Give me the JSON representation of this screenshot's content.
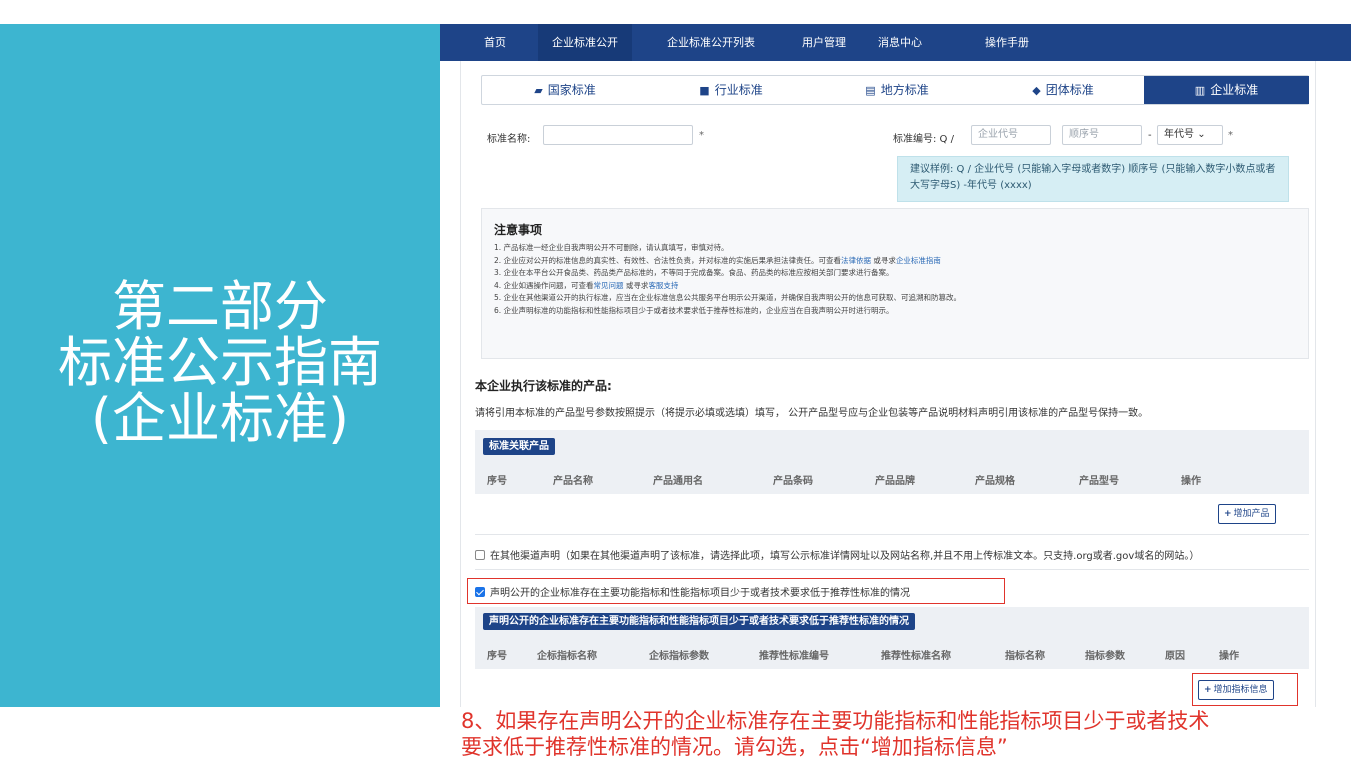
{
  "slide": {
    "title_line1": "第二部分",
    "title_line2": "标准公示指南",
    "title_line3": "(企业标准)",
    "caption": "8、如果存在声明公开的企业标准存在主要功能指标和性能指标项目少于或者技术要求低于推荐性标准的情况。请勾选，点击“增加指标信息”"
  },
  "nav": [
    "首页",
    "企业标准公开",
    "企业标准公开列表",
    "用户管理",
    "消息中心",
    "操作手册"
  ],
  "tabs": [
    {
      "label": "国家标准",
      "icon": "book-icon"
    },
    {
      "label": "行业标准",
      "icon": "briefcase-icon"
    },
    {
      "label": "地方标准",
      "icon": "document-icon"
    },
    {
      "label": "团体标准",
      "icon": "shield-icon"
    },
    {
      "label": "企业标准",
      "icon": "bank-icon"
    }
  ],
  "form": {
    "name_label": "标准名称:",
    "name_required": "*",
    "code_label": "标准编号: Q /",
    "code_company_placeholder": "企业代号",
    "code_seq_placeholder": "顺序号",
    "code_sep": "-",
    "code_year": "年代号",
    "code_required": "*",
    "hint": "建议样例: Q / 企业代号 (只能输入字母或者数字) 顺序号 (只能输入数字小数点或者大写字母S) -年代号 (xxxx)"
  },
  "notice": {
    "title": "注意事项",
    "l1": "1. 产品标准一经企业自我声明公开不可删除，请认真填写，审慎对待。",
    "l2a": "2. 企业应对公开的标准信息的真实性、有效性、合法性负责，并对标准的实施后果承担法律责任。可查看",
    "l2_link1": "法律依据",
    "l2b": " 或寻求",
    "l2_link2": "企业标准指南",
    "l3": "3. 企业在本平台公开食品类、药品类产品标准的，不等同于完成备案。食品、药品类的标准应按相关部门要求进行备案。",
    "l4a": "4. 企业如遇操作问题，可查看",
    "l4_link1": "常见问题",
    "l4b": " 或寻求",
    "l4_link2": "客服支持",
    "l5": "5. 企业在其他渠道公开的执行标准，应当在企业标准信息公共服务平台明示公开渠道，并确保自我声明公开的信息可获取、可追溯和防篡改。",
    "l6": "6. 企业声明标准的功能指标和性能指标项目少于或者技术要求低于推荐性标准的，企业应当在自我声明公开时进行明示。"
  },
  "products": {
    "title": "本企业执行该标准的产品:",
    "desc": "请将引用本标准的产品型号参数按照提示（将提示必填或选填）填写， 公开产品型号应与企业包装等产品说明材料声明引用该标准的产品型号保持一致。",
    "badge": "标准关联产品",
    "columns": [
      "序号",
      "产品名称",
      "产品通用名",
      "产品条码",
      "产品品牌",
      "产品规格",
      "产品型号",
      "操作"
    ],
    "add_button": "增加产品"
  },
  "other_channel": {
    "checked": false,
    "label": "在其他渠道声明（如果在其他渠道声明了该标准，请选择此项，填写公示标准详情网址以及网站名称,并且不用上传标准文本。只支持.org或者.gov域名的网站。）"
  },
  "declare": {
    "checked": true,
    "label": "声明公开的企业标准存在主要功能指标和性能指标项目少于或者技术要求低于推荐性标准的情况",
    "badge": "声明公开的企业标准存在主要功能指标和性能指标项目少于或者技术要求低于推荐性标准的情况",
    "columns": [
      "序号",
      "企标指标名称",
      "企标指标参数",
      "推荐性标准编号",
      "推荐性标准名称",
      "指标名称",
      "指标参数",
      "原因",
      "操作"
    ],
    "add_button": "增加指标信息"
  }
}
